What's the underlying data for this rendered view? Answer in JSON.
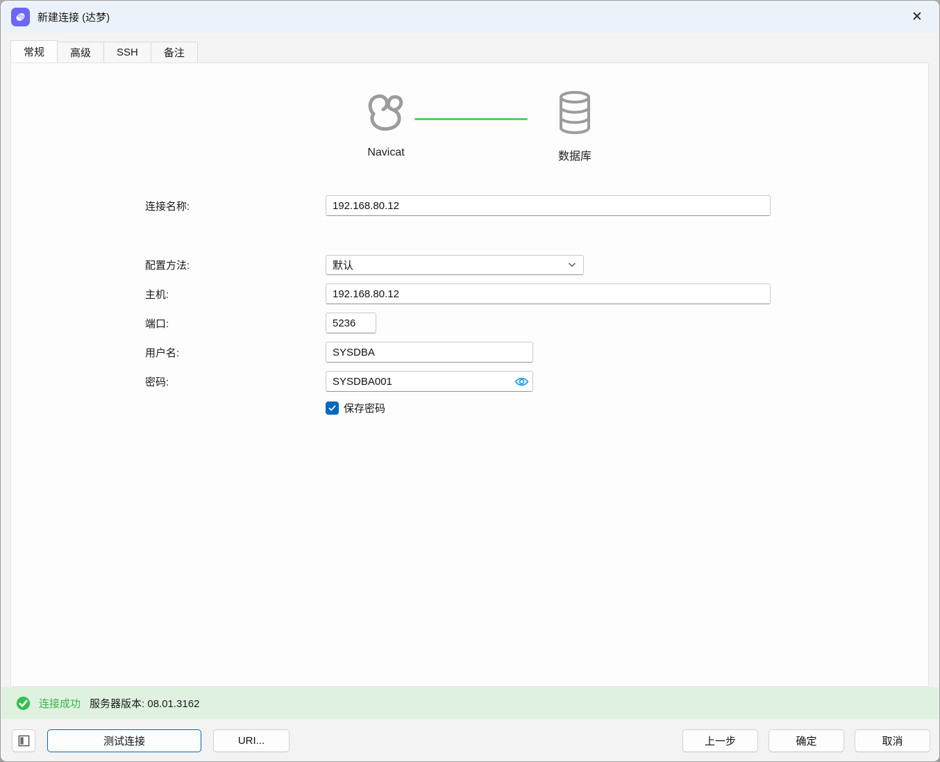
{
  "window": {
    "title": "新建连接 (达梦)",
    "close_glyph": "✕"
  },
  "tabs": [
    {
      "label": "常规"
    },
    {
      "label": "高级"
    },
    {
      "label": "SSH"
    },
    {
      "label": "备注"
    }
  ],
  "graphic": {
    "source_label": "Navicat",
    "target_label": "数据库",
    "line_color": "#4ed35a"
  },
  "form": {
    "connection_name": {
      "label": "连接名称:",
      "value": "192.168.80.12"
    },
    "config_method": {
      "label": "配置方法:",
      "value": "默认"
    },
    "host": {
      "label": "主机:",
      "value": "192.168.80.12"
    },
    "port": {
      "label": "端口:",
      "value": "5236"
    },
    "username": {
      "label": "用户名:",
      "value": "SYSDBA"
    },
    "password": {
      "label": "密码:",
      "value": "SYSDBA001"
    },
    "save_password": {
      "label": "保存密码",
      "checked": true
    }
  },
  "status": {
    "result": "连接成功",
    "detail": "服务器版本: 08.01.3162",
    "success_color": "#3eb24b",
    "bar_color": "#def2df"
  },
  "footer": {
    "test_button": "测试连接",
    "uri_button": "URI...",
    "back_button": "上一步",
    "ok_button": "确定",
    "cancel_button": "取消"
  },
  "colors": {
    "titlebar_bg": "#ebf2f9",
    "accent_blue": "#0067c0",
    "app_icon_purple": "#6d66f6"
  }
}
